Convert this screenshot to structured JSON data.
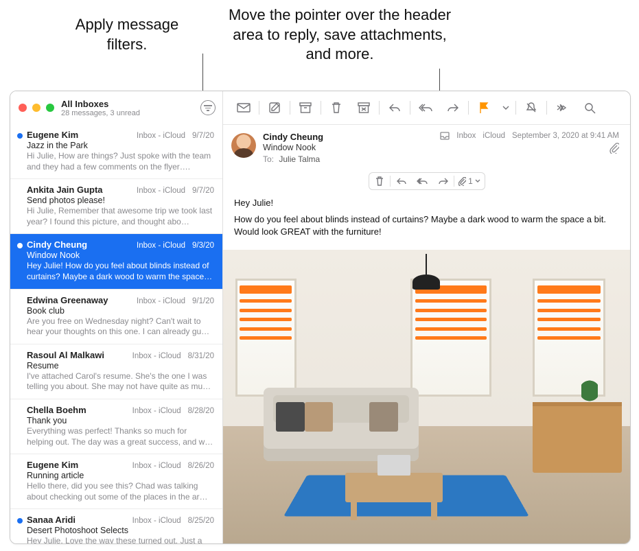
{
  "annotations": {
    "filters": "Apply message filters.",
    "hover": "Move the pointer over the header area to reply, save attachments, and more."
  },
  "sidebar": {
    "title": "All Inboxes",
    "subtitle": "28 messages, 3 unread"
  },
  "messages": [
    {
      "sender": "Eugene Kim",
      "mailbox": "Inbox - iCloud",
      "date": "9/7/20",
      "subject": "Jazz in the Park",
      "preview": "Hi Julie, How are things? Just spoke with the team and they had a few comments on the flyer….",
      "unread": true,
      "selected": false
    },
    {
      "sender": "Ankita Jain Gupta",
      "mailbox": "Inbox - iCloud",
      "date": "9/7/20",
      "subject": "Send photos please!",
      "preview": "Hi Julie, Remember that awesome trip we took last year? I found this picture, and thought abo…",
      "unread": false,
      "selected": false
    },
    {
      "sender": "Cindy Cheung",
      "mailbox": "Inbox - iCloud",
      "date": "9/3/20",
      "subject": "Window Nook",
      "preview": "Hey Julie! How do you feel about blinds instead of curtains? Maybe a dark wood to warm the space…",
      "unread": true,
      "selected": true
    },
    {
      "sender": "Edwina Greenaway",
      "mailbox": "Inbox - iCloud",
      "date": "9/1/20",
      "subject": "Book club",
      "preview": "Are you free on Wednesday night? Can't wait to hear your thoughts on this one. I can already gu…",
      "unread": false,
      "selected": false
    },
    {
      "sender": "Rasoul Al Malkawi",
      "mailbox": "Inbox - iCloud",
      "date": "8/31/20",
      "subject": "Resume",
      "preview": "I've attached Carol's resume. She's the one I was telling you about. She may not have quite as mu…",
      "unread": false,
      "selected": false
    },
    {
      "sender": "Chella Boehm",
      "mailbox": "Inbox - iCloud",
      "date": "8/28/20",
      "subject": "Thank you",
      "preview": "Everything was perfect! Thanks so much for helping out. The day was a great success, and w…",
      "unread": false,
      "selected": false
    },
    {
      "sender": "Eugene Kim",
      "mailbox": "Inbox - iCloud",
      "date": "8/26/20",
      "subject": "Running article",
      "preview": "Hello there, did you see this? Chad was talking about checking out some of the places in the ar…",
      "unread": false,
      "selected": false
    },
    {
      "sender": "Sanaa Aridi",
      "mailbox": "Inbox - iCloud",
      "date": "8/25/20",
      "subject": "Desert Photoshoot Selects",
      "preview": "Hey Julie, Love the way these turned out. Just a",
      "unread": true,
      "selected": false
    }
  ],
  "viewer": {
    "from": "Cindy Cheung",
    "subject": "Window Nook",
    "to_label": "To:",
    "to_name": "Julie Talma",
    "mailbox_parent": "Inbox",
    "mailbox_account": "iCloud",
    "date": "September 3, 2020 at 9:41 AM",
    "attachment_count": "1",
    "body_line1": "Hey Julie!",
    "body_line2": "How do you feel about blinds instead of curtains? Maybe a dark wood to warm the space a bit. Would look GREAT with the furniture!"
  }
}
